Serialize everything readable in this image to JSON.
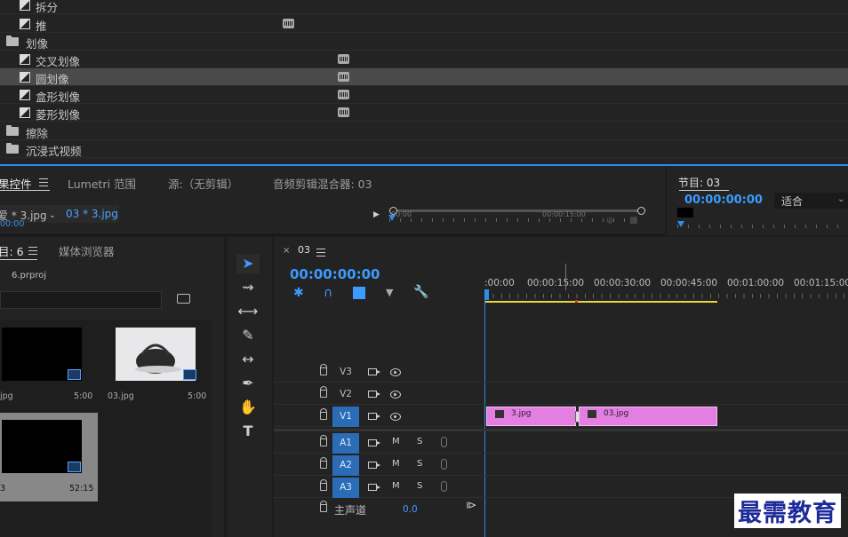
{
  "effects": {
    "rows": [
      {
        "label": "拆分",
        "type": "item",
        "badge": false
      },
      {
        "label": "推",
        "type": "item",
        "badge": true
      },
      {
        "label": "划像",
        "type": "folder",
        "badge": false
      },
      {
        "label": "交叉划像",
        "type": "item",
        "badge": true
      },
      {
        "label": "圆划像",
        "type": "item",
        "badge": true,
        "selected": true
      },
      {
        "label": "盒形划像",
        "type": "item",
        "badge": true
      },
      {
        "label": "菱形划像",
        "type": "item",
        "badge": true
      },
      {
        "label": "擦除",
        "type": "folder",
        "badge": false
      },
      {
        "label": "沉浸式视频",
        "type": "folder",
        "badge": false
      }
    ]
  },
  "tabs": {
    "effect_controls": "果控件",
    "lumetri": "Lumetri 范围",
    "source": "源:（无剪辑）",
    "audio_mixer": "音频剪辑混合器: 03",
    "clip_left": "爱 * 3.jpg",
    "clip_right": "03 * 3.jpg",
    "tc_small": "00:00",
    "tc_ruler_a": "00:00",
    "tc_ruler_b": "00:00:15:00"
  },
  "program": {
    "title": "节目: 03",
    "timecode": "00:00:00:00",
    "fit": "适合"
  },
  "project": {
    "title": "目: 6",
    "media_browser": "媒体浏览器",
    "file": "6.prproj",
    "items": [
      {
        "name": "jpg",
        "duration": "5:00"
      },
      {
        "name": "03.jpg",
        "duration": "5:00"
      },
      {
        "name": "3",
        "duration": "52:15"
      }
    ]
  },
  "timeline": {
    "sequence": "03",
    "timecode": "00:00:00:00",
    "ruler": [
      ":00:00",
      "00:00:15:00",
      "00:00:30:00",
      "00:00:45:00",
      "00:01:00:00",
      "00:01:15:00"
    ],
    "video_tracks": [
      "V3",
      "V2",
      "V1"
    ],
    "audio_tracks": [
      "A1",
      "A2",
      "A3"
    ],
    "mute": "M",
    "solo": "S",
    "master_label": "主声道",
    "master_value": "0.0",
    "clips": [
      {
        "name": "3.jpg"
      },
      {
        "name": "03.jpg"
      }
    ]
  },
  "logo": "最需教育",
  "colors": {
    "accent": "#2d8ceb",
    "clip": "#e27fe0",
    "work_area": "#e8d63a"
  }
}
